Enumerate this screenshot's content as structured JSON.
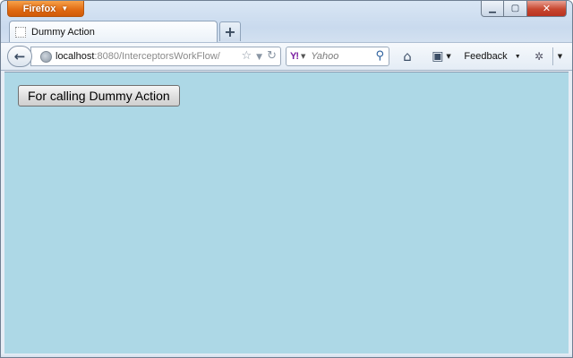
{
  "browser": {
    "app_button_label": "Firefox",
    "window_controls": {
      "minimize": "▭",
      "maximize": "▢",
      "close": "✕"
    }
  },
  "tabs": [
    {
      "title": "Dummy Action"
    }
  ],
  "new_tab_label": "+",
  "address_bar": {
    "host": "localhost",
    "rest": ":8080/InterceptorsWorkFlow/"
  },
  "search_bar": {
    "engine_logo": "Y!",
    "placeholder": "Yahoo"
  },
  "toolbar": {
    "feedback_label": "Feedback"
  },
  "page": {
    "background_color": "#add8e6",
    "button_label": "For calling Dummy Action"
  },
  "icons": {
    "back": "back-arrow-icon",
    "globe": "globe-icon",
    "bookmark_star": "star-icon",
    "reload": "reload-icon",
    "search_go": "magnifier-icon",
    "home": "home-icon",
    "bookmarks": "bookmarks-icon",
    "bug": "bug-icon"
  }
}
